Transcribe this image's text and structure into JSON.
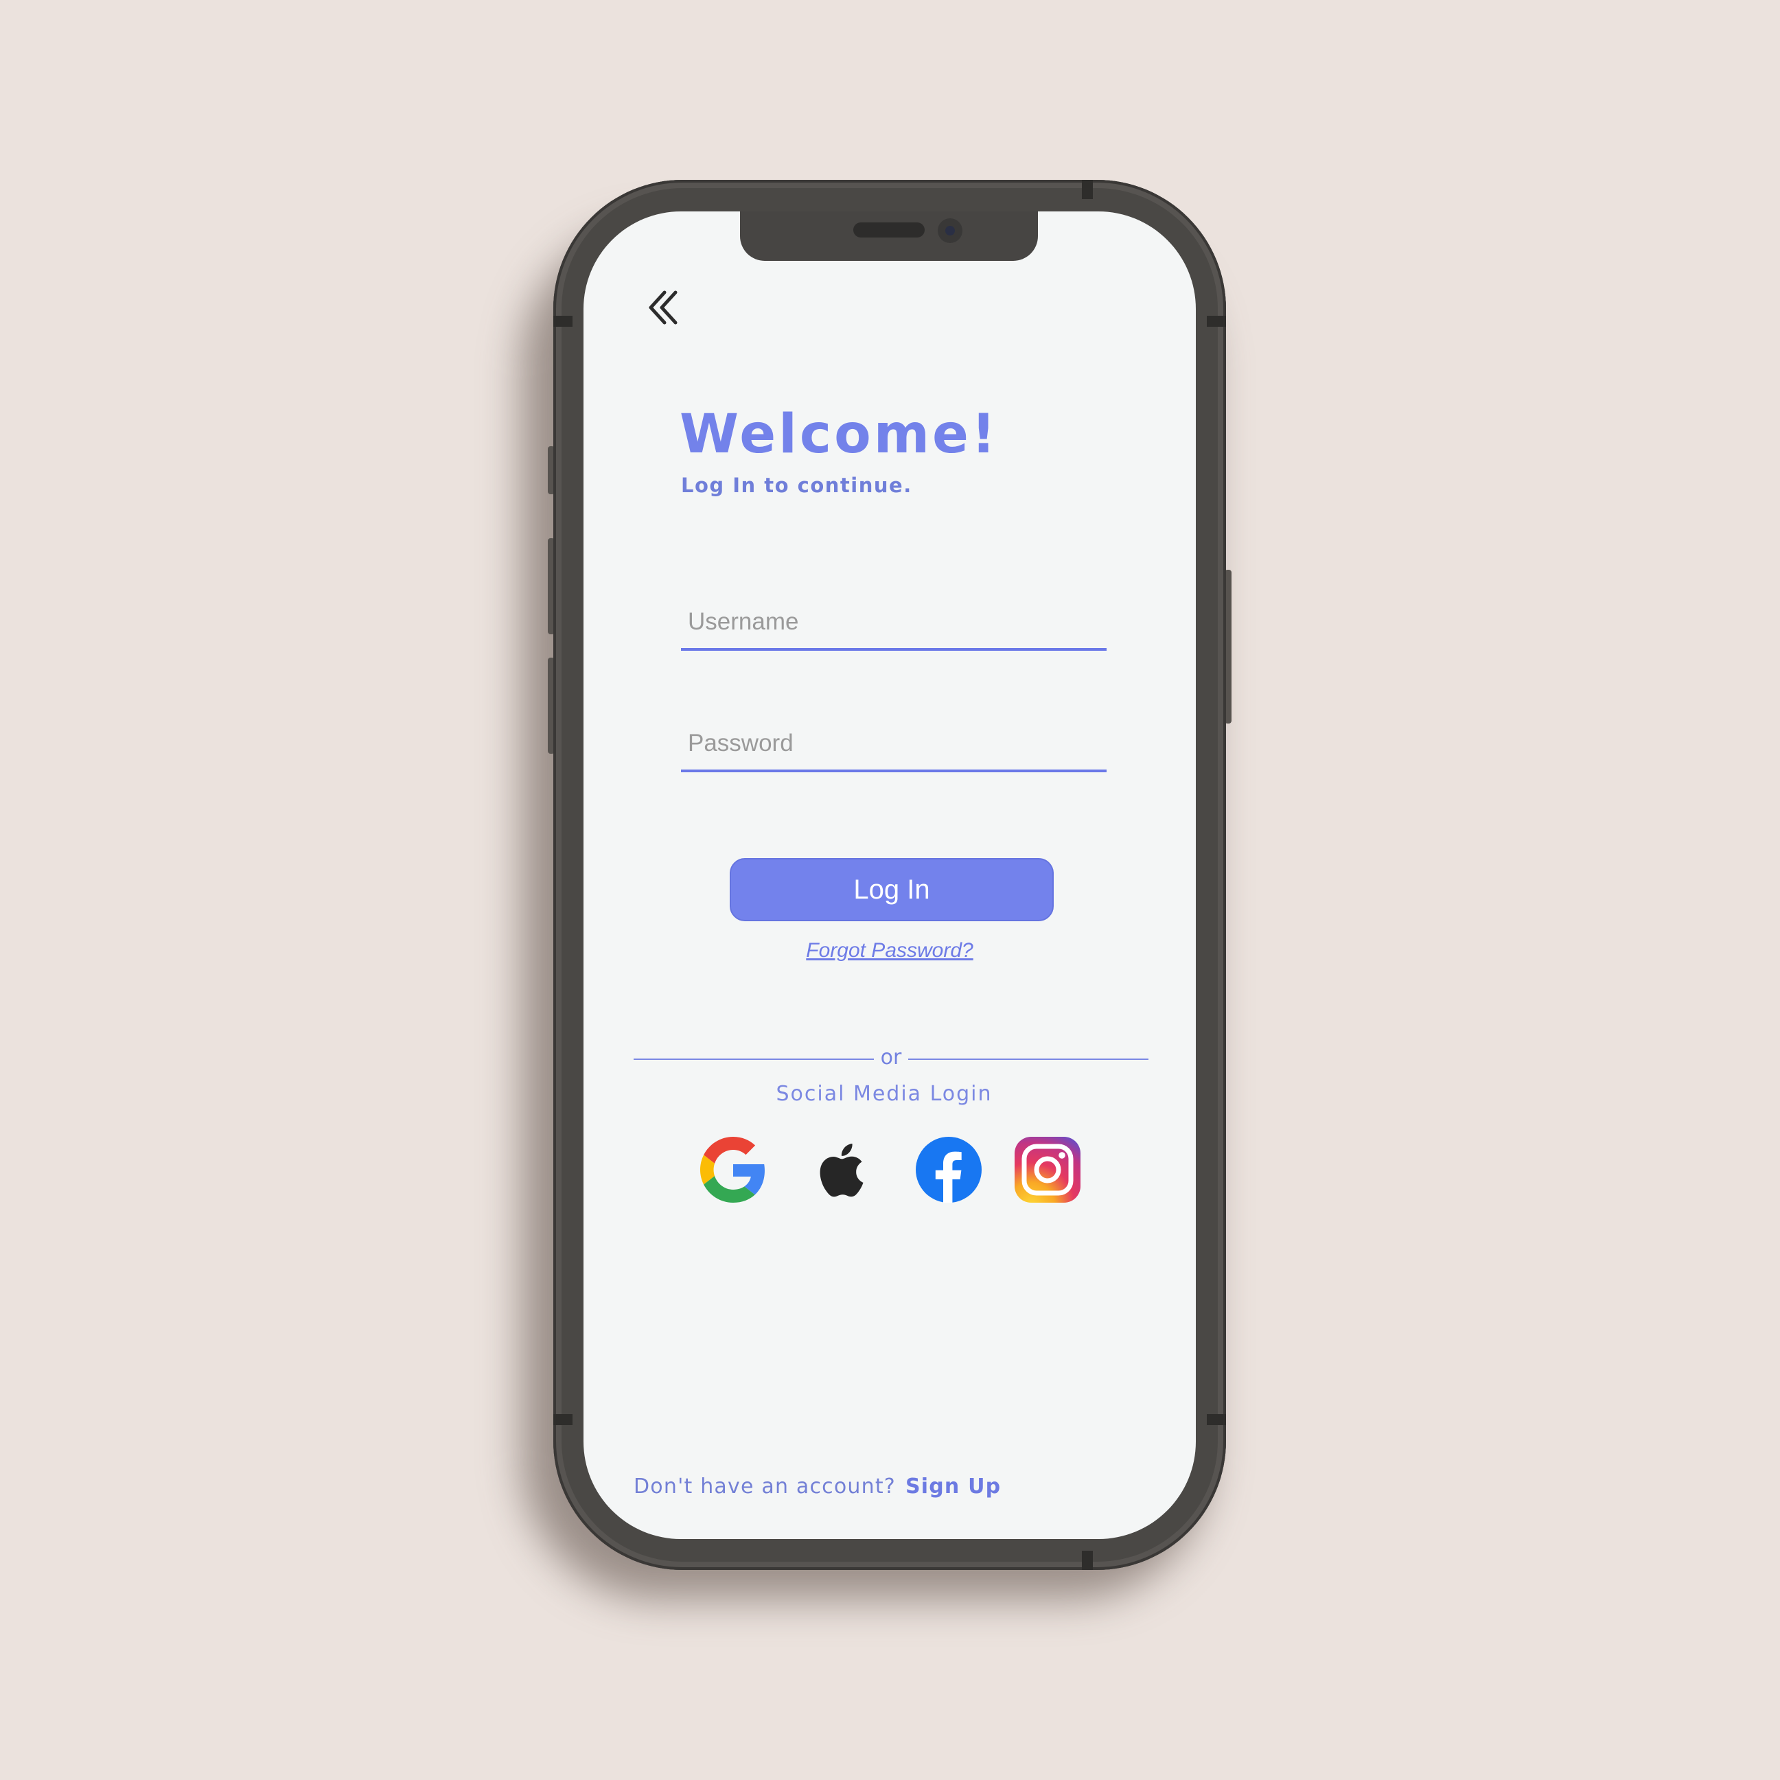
{
  "colors": {
    "background": "#ebe2dd",
    "accent": "#7382ec",
    "screen": "#f4f6f6",
    "phone_frame": "#4a4845"
  },
  "header": {
    "back_icon": "double-chevron-left-icon"
  },
  "welcome": {
    "title": "Welcome!",
    "subtitle": "Log In to continue."
  },
  "form": {
    "username": {
      "placeholder": "Username",
      "value": ""
    },
    "password": {
      "placeholder": "Password",
      "value": ""
    },
    "login_label": "Log In",
    "forgot_label": "Forgot Password?"
  },
  "divider": {
    "text": "or"
  },
  "social": {
    "label": "Social Media Login",
    "providers": [
      {
        "name": "Google",
        "icon": "google-icon"
      },
      {
        "name": "Apple",
        "icon": "apple-icon"
      },
      {
        "name": "Facebook",
        "icon": "facebook-icon"
      },
      {
        "name": "Instagram",
        "icon": "instagram-icon"
      }
    ]
  },
  "footer": {
    "prompt": "Don't have an account?",
    "signup_label": "Sign Up"
  }
}
